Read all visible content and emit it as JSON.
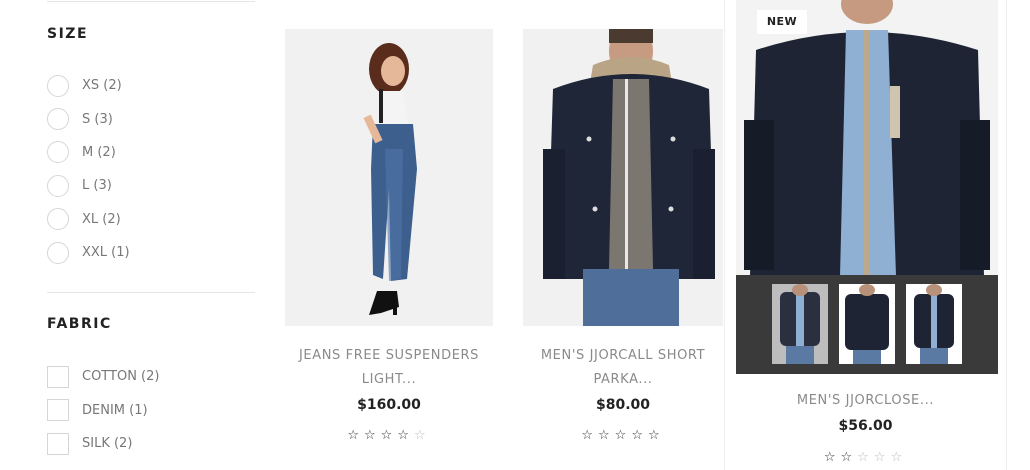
{
  "filters": {
    "size": {
      "title": "SIZE",
      "options": [
        {
          "label": "XS (2)"
        },
        {
          "label": "S (3)"
        },
        {
          "label": "M (2)"
        },
        {
          "label": "L (3)"
        },
        {
          "label": "XL (2)"
        },
        {
          "label": "XXL (1)"
        }
      ]
    },
    "fabric": {
      "title": "FABRIC",
      "options": [
        {
          "label": "COTTON (2)"
        },
        {
          "label": "DENIM (1)"
        },
        {
          "label": "SILK (2)"
        }
      ]
    }
  },
  "products": [
    {
      "title_line1": "JEANS FREE SUSPENDERS",
      "title_line2": "LIGHT...",
      "price": "$160.00",
      "rating": 4,
      "rating_max": 5
    },
    {
      "title_line1": "MEN'S JJORCALL SHORT",
      "title_line2": "PARKA...",
      "price": "$80.00",
      "rating": 5,
      "rating_max": 5
    },
    {
      "badge": "NEW",
      "title_line1": "MEN'S JJORCLOSE...",
      "price": "$56.00",
      "rating": 2,
      "rating_max": 5
    }
  ]
}
